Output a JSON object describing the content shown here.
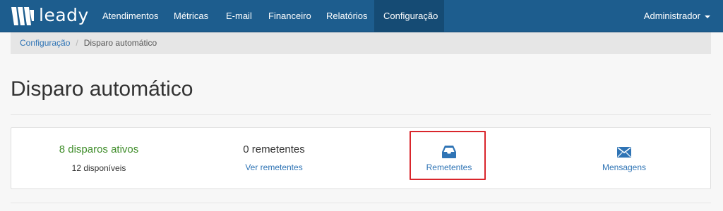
{
  "brand": {
    "name": "leady"
  },
  "nav": {
    "items": [
      {
        "label": "Atendimentos"
      },
      {
        "label": "Métricas"
      },
      {
        "label": "E-mail"
      },
      {
        "label": "Financeiro"
      },
      {
        "label": "Relatórios"
      },
      {
        "label": "Configuração",
        "active": true
      }
    ],
    "user_menu": "Administrador"
  },
  "breadcrumb": {
    "parent": "Configuração",
    "separator": "/",
    "current": "Disparo automático"
  },
  "page": {
    "title": "Disparo automático"
  },
  "stats": {
    "disparos": {
      "main": "8 disparos ativos",
      "sub": "12 disponíveis"
    },
    "remetentes": {
      "main": "0 remetentes",
      "link": "Ver remetentes"
    },
    "remetentes_button": {
      "label": "Remetentes",
      "icon": "inbox-icon"
    },
    "mensagens_button": {
      "label": "Mensagens",
      "icon": "envelope-icon"
    }
  },
  "colors": {
    "navbar": "#1d5d8e",
    "navbar_active": "#154b74",
    "link": "#2f74b5",
    "success": "#3f8d2a",
    "highlight": "#d9262c"
  }
}
